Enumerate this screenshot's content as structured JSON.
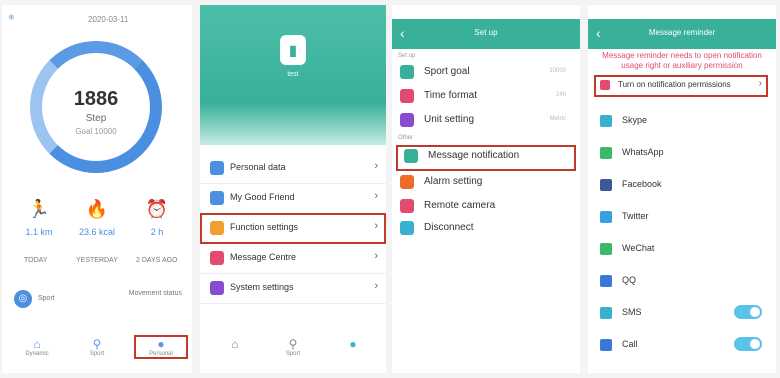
{
  "panel1": {
    "app_label": "",
    "date": "2020-03-11",
    "steps": "1886",
    "steps_unit": "Step",
    "goal": "Goal 10000",
    "stats": [
      {
        "icon": "run-icon",
        "glyph": "🏃",
        "value": "1.1 km"
      },
      {
        "icon": "flame-icon",
        "glyph": "🔥",
        "value": "23.6 kcal"
      },
      {
        "icon": "alarm-icon",
        "glyph": "⏰",
        "value": "2 h"
      }
    ],
    "days": [
      "TODAY",
      "YESTERDAY",
      "2 DAYS AGO"
    ],
    "sport_label": "Sport",
    "sport_note": "Movement status",
    "nav": [
      {
        "label": "Dynamic",
        "icon": "home-icon"
      },
      {
        "label": "Sport",
        "icon": "run-icon"
      },
      {
        "label": "Personal",
        "icon": "person-icon"
      }
    ]
  },
  "panel2": {
    "user_name": "test",
    "header_stats": [
      "",
      "",
      ""
    ],
    "menu": [
      {
        "label": "Personal data",
        "value": "",
        "color": "#4a8fe0"
      },
      {
        "label": "My Good Friend",
        "value": "",
        "color": "#4a8fe0"
      },
      {
        "label": "Function settings",
        "value": "",
        "color": "#f0a030"
      },
      {
        "label": "Message Centre",
        "value": "",
        "color": "#e34b6e"
      },
      {
        "label": "System settings",
        "value": "",
        "color": "#8a4dd0"
      }
    ],
    "nav": [
      {
        "label": "",
        "icon": "home-icon"
      },
      {
        "label": "Sport",
        "icon": "run-icon"
      },
      {
        "label": "",
        "icon": "person-icon"
      }
    ]
  },
  "panel3": {
    "title": "Set up",
    "section1": "Set up",
    "section2": "Other",
    "rows": [
      {
        "label": "Sport goal",
        "value": "10000",
        "color": "#38b09a"
      },
      {
        "label": "Time format",
        "value": "24h",
        "color": "#e34b6e"
      },
      {
        "label": "Unit setting",
        "value": "Metric",
        "color": "#8a4dd0"
      },
      {
        "label": "Message notification",
        "value": "",
        "color": "#38b09a"
      },
      {
        "label": "Alarm setting",
        "value": "",
        "color": "#f06a2a"
      },
      {
        "label": "Remote camera",
        "value": "",
        "color": "#e34b6e"
      },
      {
        "label": "Disconnect",
        "value": "",
        "color": "#38b0d0"
      }
    ]
  },
  "panel4": {
    "title": "Message reminder",
    "warning": "Message reminder needs to open notification usage right or auxiliary permission",
    "permission_label": "Turn on notification permissions",
    "apps": [
      {
        "label": "Skype",
        "color": "#38b0d0",
        "toggle": false
      },
      {
        "label": "WhatsApp",
        "color": "#3cb86a",
        "toggle": false
      },
      {
        "label": "Facebook",
        "color": "#3b5998",
        "toggle": false
      },
      {
        "label": "Twitter",
        "color": "#38a0e0",
        "toggle": false
      },
      {
        "label": "WeChat",
        "color": "#3cb86a",
        "toggle": false
      },
      {
        "label": "QQ",
        "color": "#3b78d8",
        "toggle": false
      },
      {
        "label": "SMS",
        "color": "#38b0d0",
        "toggle": true
      },
      {
        "label": "Call",
        "color": "#3b78d8",
        "toggle": true
      }
    ]
  },
  "colors": {
    "accent": "#38b09a",
    "ring": "#4a8fe0",
    "highlight": "#c0392b",
    "toggle": "#5cc3e8"
  }
}
